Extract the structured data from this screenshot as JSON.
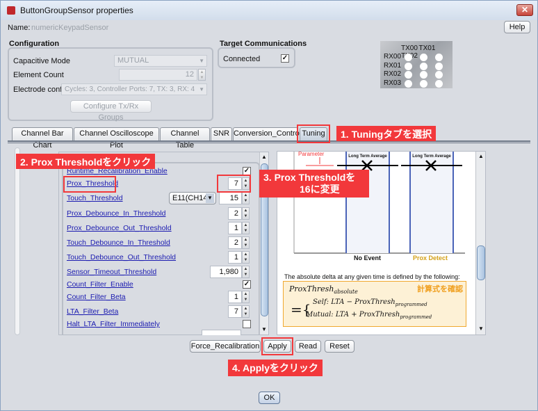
{
  "window": {
    "title": "ButtonGroupSensor properties",
    "close": "✕"
  },
  "name_row": {
    "label": "Name:",
    "value": "numericKeypadSensor",
    "help": "Help"
  },
  "configuration": {
    "title": "Configuration",
    "capacitive_mode_label": "Capacitive Mode",
    "capacitive_mode_value": "MUTUAL",
    "element_count_label": "Element Count",
    "element_count_value": "12",
    "electrode_label": "Electrode config",
    "electrode_value": "Cycles:  3, Controller Ports:  7, TX:  3, RX:  4",
    "configure_button": "Configure Tx/Rx Groups"
  },
  "target": {
    "title": "Target Communications",
    "connected_label": "Connected",
    "connected": true
  },
  "matrix": {
    "columns": [
      "TX00",
      "TX01",
      "TX02"
    ],
    "rows": [
      "RX00",
      "RX01",
      "RX02",
      "RX03"
    ]
  },
  "tabs": [
    "Channel Bar Chart",
    "Channel Oscilloscope Plot",
    "Channel Table",
    "SNR",
    "Conversion_Control",
    "Tuning"
  ],
  "active_tab": "Tuning",
  "params": [
    {
      "label": "Runtime_Recalibration_Enable",
      "type": "checkbox",
      "checked": true
    },
    {
      "label": "Prox_Threshold",
      "type": "spinner",
      "value": "7"
    },
    {
      "label": "Touch_Threshold",
      "type": "spinner",
      "value": "15",
      "channel": "E11(CH14)"
    },
    {
      "label": "Prox_Debounce_In_Threshold",
      "type": "spinner",
      "value": "2"
    },
    {
      "label": "Prox_Debounce_Out_Threshold",
      "type": "spinner",
      "value": "1"
    },
    {
      "label": "Touch_Debounce_In_Threshold",
      "type": "spinner",
      "value": "2"
    },
    {
      "label": "Touch_Debounce_Out_Threshold",
      "type": "spinner",
      "value": "1"
    },
    {
      "label": "Sensor_Timeout_Threshold",
      "type": "spinner",
      "value": "1,980"
    },
    {
      "label": "Count_Filter_Enable",
      "type": "checkbox",
      "checked": true
    },
    {
      "label": "Count_Filter_Beta",
      "type": "spinner",
      "value": "1"
    },
    {
      "label": "LTA_Filter_Beta",
      "type": "spinner",
      "value": "7"
    },
    {
      "label": "Halt_LTA_Filter_Immediately",
      "type": "checkbox",
      "checked": false
    }
  ],
  "diagram": {
    "parameter": "Parameter",
    "lta1": "Long Term Average",
    "lta2": "Long Term Average",
    "no_event": "No Event",
    "prox_detect": "Prox Detect",
    "explanation": "The absolute delta at any given time is defined by the following:",
    "formula_lhs": "ProxThresh",
    "formula_lhs_sub": "absolute",
    "formula_self": "Self:  LTA − ProxThresh",
    "formula_mutual": "Mutual:  LTA + ProxThresh",
    "formula_sub": "programmed",
    "note": "計算式を確認"
  },
  "buttons": {
    "force": "Force_Recalibration",
    "apply": "Apply",
    "read": "Read",
    "reset": "Reset",
    "ok": "OK"
  },
  "callouts": {
    "step1": "1. Tuningタブを選択",
    "step2": "2. Prox Thresholdをクリック",
    "step3a": "3. Prox Thresholdを",
    "step3b": "16に変更",
    "step4": "4. Applyをクリック"
  },
  "colors": {
    "callout": "#f2383b",
    "link": "#1a1ab0",
    "prox_detect": "#d4a017"
  }
}
